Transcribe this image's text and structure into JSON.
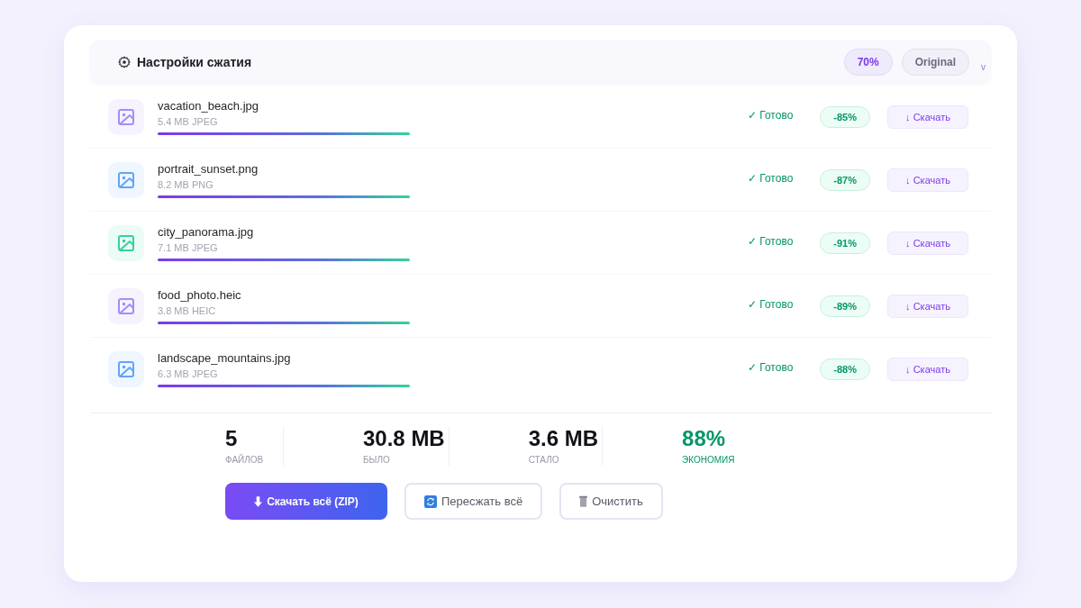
{
  "settings": {
    "title": "Настройки сжатия",
    "pills": [
      {
        "text": "70%",
        "kind": "quality"
      },
      {
        "text": "Original",
        "kind": "format"
      }
    ],
    "toggle": "v"
  },
  "files": [
    {
      "name": "vacation_beach.jpg",
      "meta": "5.4 MB JPEG",
      "color": "#a78bfa",
      "level": 1,
      "status": "✓ Готово",
      "savings": "-85%",
      "download": "↓ Скачать"
    },
    {
      "name": "portrait_sunset.png",
      "meta": "8.2 MB PNG",
      "color": "#60a5fa",
      "level": 1,
      "status": "✓ Готово",
      "savings": "-87%",
      "download": "↓ Скачать"
    },
    {
      "name": "city_panorama.jpg",
      "meta": "7.1 MB JPEG",
      "color": "#34d399",
      "level": 1,
      "status": "✓ Готово",
      "savings": "-91%",
      "download": "↓ Скачать"
    },
    {
      "name": "food_photo.heic",
      "meta": "3.8 MB HEIC",
      "color": "#a78bfa",
      "level": 1,
      "status": "✓ Готово",
      "savings": "-89%",
      "download": "↓ Скачать"
    },
    {
      "name": "landscape_mountains.jpg",
      "meta": "6.3 MB JPEG",
      "color": "#60a5fa",
      "level": 1,
      "status": "✓ Готово",
      "savings": "-88%",
      "download": "↓ Скачать"
    }
  ],
  "summary": {
    "stats": [
      {
        "value": "5",
        "label": "ФАЙЛОВ",
        "kind": "plain"
      },
      {
        "value": "30.8 MB",
        "label": "БЫЛО",
        "kind": "plain"
      },
      {
        "value": "3.6 MB",
        "label": "СТАЛО",
        "kind": "plain"
      },
      {
        "value": "88%",
        "label": "ЭКОНОМИЯ",
        "kind": "highlight"
      }
    ]
  },
  "actions": [
    {
      "label": "Скачать всё (ZIP)",
      "kind": "primary"
    },
    {
      "label": "Пересжать всё",
      "kind": "recompress"
    },
    {
      "label": "Очистить",
      "kind": "clear"
    }
  ]
}
